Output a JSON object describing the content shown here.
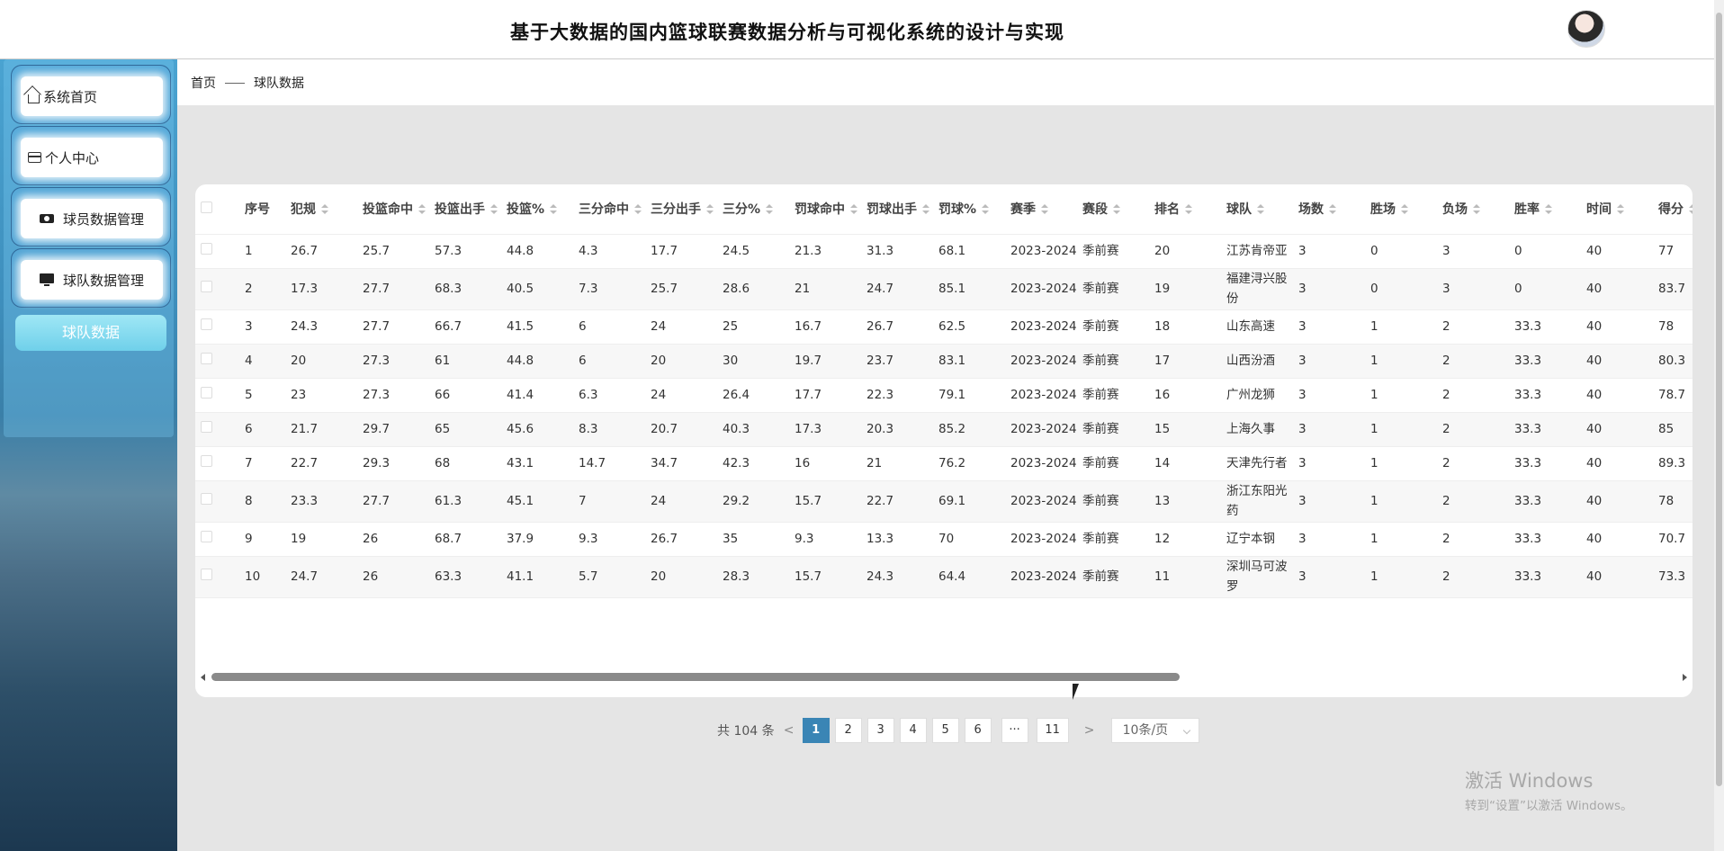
{
  "header": {
    "title": "基于大数据的国内篮球联赛数据分析与可视化系统的设计与实现"
  },
  "sidebar": {
    "items": [
      {
        "label": "系统首页",
        "icon": "home-icon"
      },
      {
        "label": "个人中心",
        "icon": "card-icon"
      },
      {
        "label": "球员数据管理",
        "icon": "ticket-icon"
      },
      {
        "label": "球队数据管理",
        "icon": "monitor-icon"
      }
    ],
    "sub_item": "球队数据"
  },
  "breadcrumb": {
    "home": "首页",
    "current": "球队数据"
  },
  "table": {
    "columns": [
      "序号",
      "犯规",
      "投篮命中",
      "投篮出手",
      "投篮%",
      "三分命中",
      "三分出手",
      "三分%",
      "罚球命中",
      "罚球出手",
      "罚球%",
      "赛季",
      "赛段",
      "排名",
      "球队",
      "场数",
      "胜场",
      "负场",
      "胜率",
      "时间",
      "得分"
    ],
    "rows": [
      [
        "1",
        "26.7",
        "25.7",
        "57.3",
        "44.8",
        "4.3",
        "17.7",
        "24.5",
        "21.3",
        "31.3",
        "68.1",
        "2023-2024",
        "季前赛",
        "20",
        "江苏肯帝亚",
        "3",
        "0",
        "3",
        "0",
        "40",
        "77"
      ],
      [
        "2",
        "17.3",
        "27.7",
        "68.3",
        "40.5",
        "7.3",
        "25.7",
        "28.6",
        "21",
        "24.7",
        "85.1",
        "2023-2024",
        "季前赛",
        "19",
        "福建浔兴股份",
        "3",
        "0",
        "3",
        "0",
        "40",
        "83.7"
      ],
      [
        "3",
        "24.3",
        "27.7",
        "66.7",
        "41.5",
        "6",
        "24",
        "25",
        "16.7",
        "26.7",
        "62.5",
        "2023-2024",
        "季前赛",
        "18",
        "山东高速",
        "3",
        "1",
        "2",
        "33.3",
        "40",
        "78"
      ],
      [
        "4",
        "20",
        "27.3",
        "61",
        "44.8",
        "6",
        "20",
        "30",
        "19.7",
        "23.7",
        "83.1",
        "2023-2024",
        "季前赛",
        "17",
        "山西汾酒",
        "3",
        "1",
        "2",
        "33.3",
        "40",
        "80.3"
      ],
      [
        "5",
        "23",
        "27.3",
        "66",
        "41.4",
        "6.3",
        "24",
        "26.4",
        "17.7",
        "22.3",
        "79.1",
        "2023-2024",
        "季前赛",
        "16",
        "广州龙狮",
        "3",
        "1",
        "2",
        "33.3",
        "40",
        "78.7"
      ],
      [
        "6",
        "21.7",
        "29.7",
        "65",
        "45.6",
        "8.3",
        "20.7",
        "40.3",
        "17.3",
        "20.3",
        "85.2",
        "2023-2024",
        "季前赛",
        "15",
        "上海久事",
        "3",
        "1",
        "2",
        "33.3",
        "40",
        "85"
      ],
      [
        "7",
        "22.7",
        "29.3",
        "68",
        "43.1",
        "14.7",
        "34.7",
        "42.3",
        "16",
        "21",
        "76.2",
        "2023-2024",
        "季前赛",
        "14",
        "天津先行者",
        "3",
        "1",
        "2",
        "33.3",
        "40",
        "89.3"
      ],
      [
        "8",
        "23.3",
        "27.7",
        "61.3",
        "45.1",
        "7",
        "24",
        "29.2",
        "15.7",
        "22.7",
        "69.1",
        "2023-2024",
        "季前赛",
        "13",
        "浙江东阳光药",
        "3",
        "1",
        "2",
        "33.3",
        "40",
        "78"
      ],
      [
        "9",
        "19",
        "26",
        "68.7",
        "37.9",
        "9.3",
        "26.7",
        "35",
        "9.3",
        "13.3",
        "70",
        "2023-2024",
        "季前赛",
        "12",
        "辽宁本钢",
        "3",
        "1",
        "2",
        "33.3",
        "40",
        "70.7"
      ],
      [
        "10",
        "24.7",
        "26",
        "63.3",
        "41.1",
        "5.7",
        "20",
        "28.3",
        "15.7",
        "24.3",
        "64.4",
        "2023-2024",
        "季前赛",
        "11",
        "深圳马可波罗",
        "3",
        "1",
        "2",
        "33.3",
        "40",
        "73.3"
      ]
    ]
  },
  "pagination": {
    "total": "共 104 条",
    "prev": "<",
    "next": ">",
    "pages": [
      "1",
      "2",
      "3",
      "4",
      "5",
      "6",
      "···",
      "11"
    ],
    "active": "1",
    "page_size": "10条/页"
  },
  "watermark": {
    "line1": "激活 Windows",
    "line2": "转到“设置”以激活 Windows。"
  }
}
